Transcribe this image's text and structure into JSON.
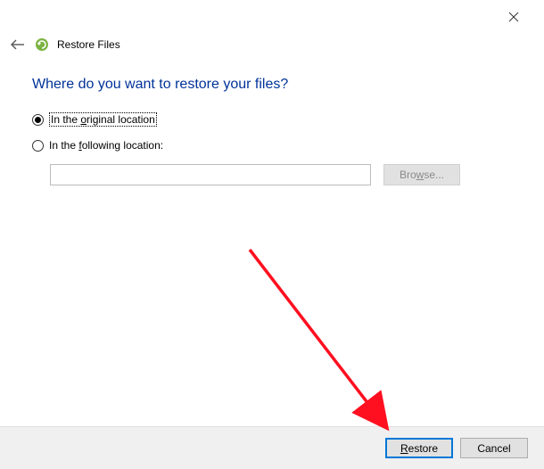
{
  "window": {
    "title": "Restore Files"
  },
  "content": {
    "question": "Where do you want to restore your files?",
    "option_original_prefix": "In the ",
    "option_original_accel": "o",
    "option_original_suffix": "riginal location",
    "option_following_prefix": "In the ",
    "option_following_accel": "f",
    "option_following_suffix": "ollowing location:",
    "location_value": "",
    "browse_prefix": "Bro",
    "browse_accel": "w",
    "browse_suffix": "se..."
  },
  "footer": {
    "restore_accel": "R",
    "restore_suffix": "estore",
    "cancel": "Cancel"
  }
}
